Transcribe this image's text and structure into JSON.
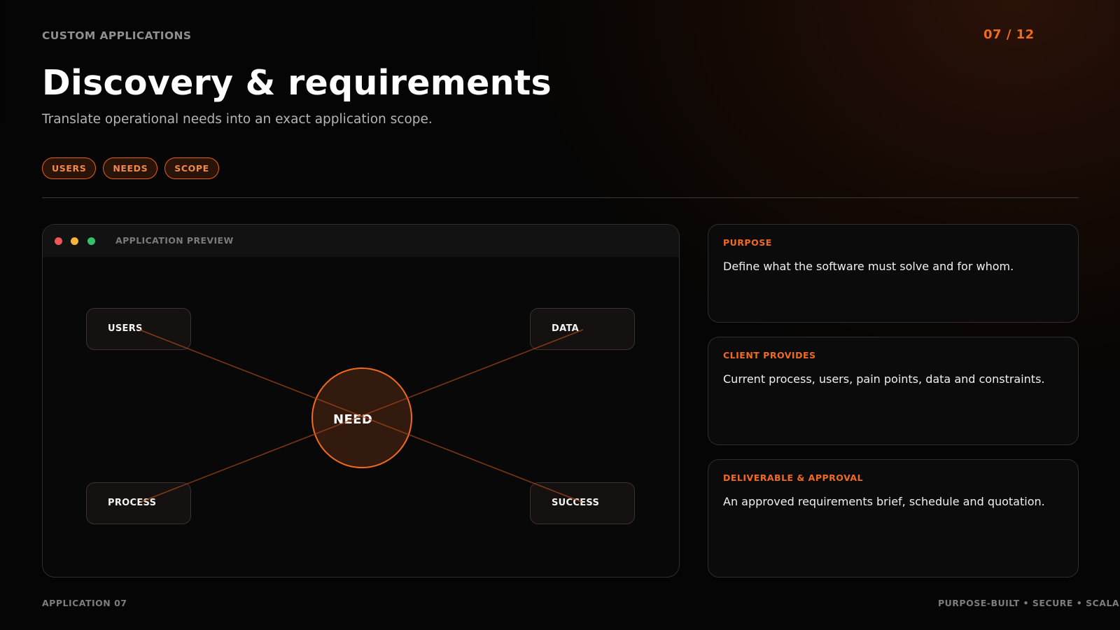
{
  "header": {
    "eyebrow": "CUSTOM APPLICATIONS",
    "page_counter": "07 / 12",
    "title": "Discovery & requirements",
    "subtitle": "Translate operational needs into an exact application scope."
  },
  "tags": [
    "USERS",
    "NEEDS",
    "SCOPE"
  ],
  "preview": {
    "label": "APPLICATION PREVIEW",
    "center_node": "NEED",
    "nodes": {
      "users": "USERS",
      "data": "DATA",
      "process": "PROCESS",
      "success": "SUCCESS"
    }
  },
  "cards": [
    {
      "label": "PURPOSE",
      "text": "Define what the software must solve and for whom."
    },
    {
      "label": "CLIENT PROVIDES",
      "text": "Current process, users, pain points, data and constraints."
    },
    {
      "label": "DELIVERABLE & APPROVAL",
      "text": "An approved requirements brief, schedule and quotation."
    }
  ],
  "footer": {
    "left": "APPLICATION 07",
    "right": "PURPOSE-BUILT • SECURE • SCALABLE"
  },
  "colors": {
    "accent": "#f26a1f",
    "background": "#050505",
    "card_border": "#2e2e2e",
    "dot_red": "#ee5555",
    "dot_yellow": "#f3b33d",
    "dot_green": "#34c16c"
  }
}
